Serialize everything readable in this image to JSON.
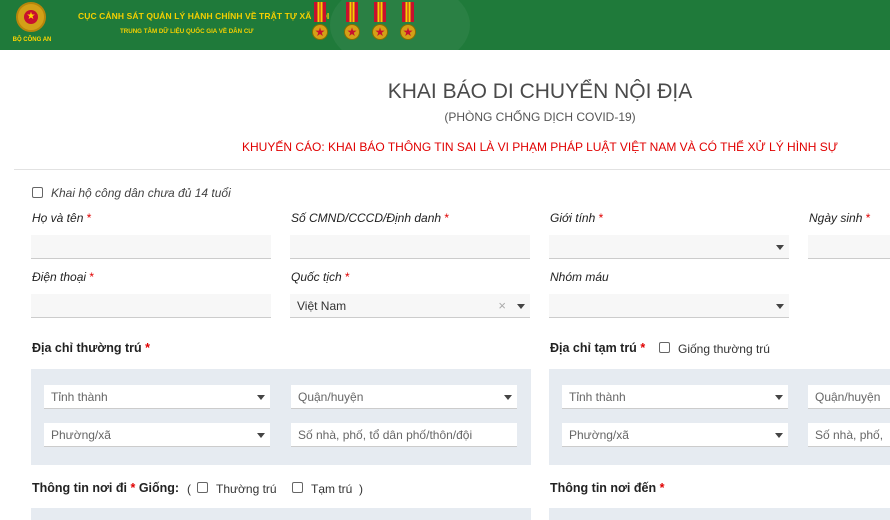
{
  "header": {
    "emblem_text": "BỘ CÔNG AN",
    "title": "CỤC CẢNH SÁT QUẢN LÝ HÀNH CHÍNH VỀ TRẬT TỰ XÃ HỘI",
    "subtitle": "TRUNG TÂM DỮ LIỆU QUỐC GIA VỀ DÂN CƯ",
    "bg_color": "#1f7a3a",
    "text_color": "#f5d000"
  },
  "page": {
    "title": "KHAI BÁO DI CHUYỂN NỘI ĐỊA",
    "subtitle": "(PHÒNG CHỐNG DỊCH COVID-19)",
    "warning": "KHUYẾN CÁO: KHAI BÁO THÔNG TIN SAI LÀ VI PHẠM PHÁP LUẬT VIỆT NAM VÀ CÓ THỂ XỬ LÝ HÌNH SỰ"
  },
  "form": {
    "under14_label": "Khai hộ công dân chưa đủ 14 tuổi",
    "required_mark": "*",
    "fullname_label": "Họ và tên",
    "id_label": "Số CMND/CCCD/Định danh",
    "gender_label": "Giới tính",
    "dob_label": "Ngày sinh",
    "phone_label": "Điện thoại",
    "nationality_label": "Quốc tịch",
    "nationality_value": "Việt Nam",
    "clear_symbol": "×",
    "blood_label": "Nhóm máu",
    "permanent_address_label": "Địa chỉ thường trú",
    "temp_address_label": "Địa chỉ tạm trú",
    "same_as_permanent_label": "Giống thường trú",
    "address_placeholders": {
      "province": "Tỉnh thành",
      "district": "Quận/huyện",
      "ward": "Phường/xã",
      "street": "Số nhà, phố, tổ dân phố/thôn/đội",
      "street_short": "Số nhà, phố,"
    },
    "departure_label": "Thông tin nơi đi",
    "same_label": "Giống:",
    "open_paren": "(",
    "close_paren": ")",
    "same_permanent": "Thường trú",
    "same_temp": "Tạm trú",
    "destination_label": "Thông tin nơi đến"
  }
}
